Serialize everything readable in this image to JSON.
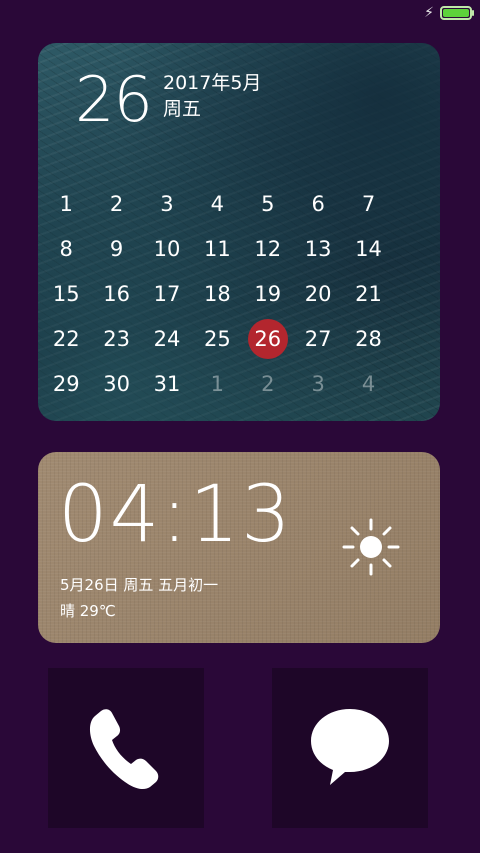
{
  "status_bar": {
    "charging_icon": "bolt-icon",
    "battery_level": 1.0,
    "battery_color": "#5dd23a"
  },
  "calendar": {
    "day": "26",
    "year_month": "2017年5月",
    "weekday": "周五",
    "today_color": "#b3262e",
    "days": [
      {
        "label": "1",
        "dim": false
      },
      {
        "label": "2",
        "dim": false
      },
      {
        "label": "3",
        "dim": false
      },
      {
        "label": "4",
        "dim": false
      },
      {
        "label": "5",
        "dim": false
      },
      {
        "label": "6",
        "dim": false
      },
      {
        "label": "7",
        "dim": false
      },
      {
        "label": "8",
        "dim": false
      },
      {
        "label": "9",
        "dim": false
      },
      {
        "label": "10",
        "dim": false
      },
      {
        "label": "11",
        "dim": false
      },
      {
        "label": "12",
        "dim": false
      },
      {
        "label": "13",
        "dim": false
      },
      {
        "label": "14",
        "dim": false
      },
      {
        "label": "15",
        "dim": false
      },
      {
        "label": "16",
        "dim": false
      },
      {
        "label": "17",
        "dim": false
      },
      {
        "label": "18",
        "dim": false
      },
      {
        "label": "19",
        "dim": false
      },
      {
        "label": "20",
        "dim": false
      },
      {
        "label": "21",
        "dim": false
      },
      {
        "label": "22",
        "dim": false
      },
      {
        "label": "23",
        "dim": false
      },
      {
        "label": "24",
        "dim": false
      },
      {
        "label": "25",
        "dim": false
      },
      {
        "label": "26",
        "dim": false,
        "today": true
      },
      {
        "label": "27",
        "dim": false
      },
      {
        "label": "28",
        "dim": false
      },
      {
        "label": "29",
        "dim": false
      },
      {
        "label": "30",
        "dim": false
      },
      {
        "label": "31",
        "dim": false
      },
      {
        "label": "1",
        "dim": true
      },
      {
        "label": "2",
        "dim": true
      },
      {
        "label": "3",
        "dim": true
      },
      {
        "label": "4",
        "dim": true
      }
    ]
  },
  "clock": {
    "time": "04:13",
    "date_line": "5月26日  周五  五月初一",
    "weather_line": "晴  29℃",
    "weather_icon": "sun-icon"
  },
  "shortcuts": [
    {
      "name": "phone",
      "icon": "phone-icon"
    },
    {
      "name": "messages",
      "icon": "message-bubble-icon"
    }
  ]
}
